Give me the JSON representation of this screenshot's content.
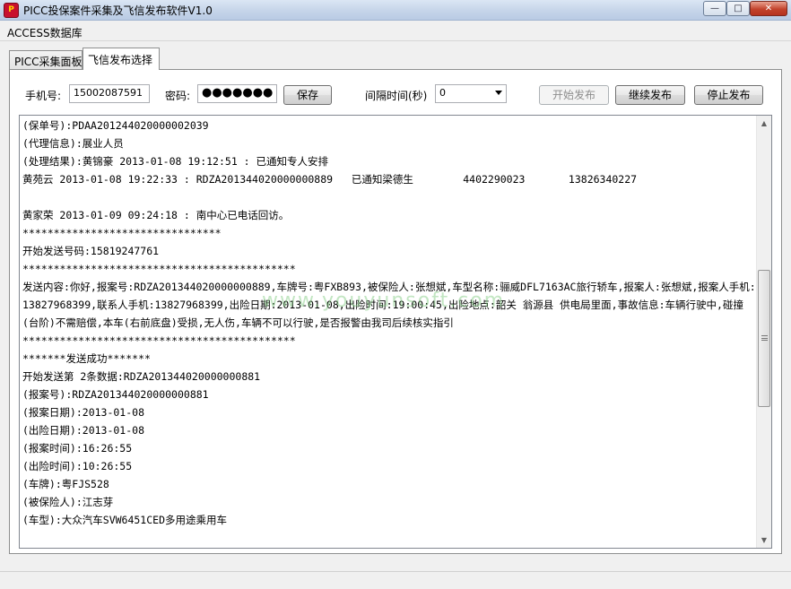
{
  "window": {
    "title": "PICC投保案件采集及飞信发布软件V1.0",
    "minimize_glyph": "—",
    "maximize_glyph": "□",
    "close_glyph": "✕",
    "app_icon_text": "P"
  },
  "menu": {
    "items": [
      "ACCESS数据库"
    ]
  },
  "tabs": [
    {
      "label": "PICC采集面板"
    },
    {
      "label": "飞信发布选择"
    }
  ],
  "form": {
    "phone_label": "手机号:",
    "phone_value": "15002087591",
    "password_label": "密码:",
    "password_value": "●●●●●●●",
    "save_label": "保存",
    "interval_label": "间隔时间(秒)",
    "interval_value": "0",
    "start_label": "开始发布",
    "continue_label": "继续发布",
    "stop_label": "停止发布"
  },
  "log": {
    "lines": [
      "(保单号):PDAA201244020000002039",
      "(代理信息):展业人员",
      "(处理结果):黄锦豪 2013-01-08 19:12:51 : 已通知专人安排",
      "黄苑云 2013-01-08 19:22:33 : RDZA201344020000000889   已通知梁德生        4402290023       13826340227",
      "",
      "黄家荣 2013-01-09 09:24:18 : 南中心已电话回访。",
      "********************************",
      "开始发送号码:15819247761",
      "********************************************",
      "发送内容:你好,报案号:RDZA201344020000000889,车牌号:粤FXB893,被保险人:张想斌,车型名称:骊威DFL7163AC旅行轿车,报案人:张想斌,报案人手机:13827968399,联系人手机:13827968399,出险日期:2013-01-08,出险时间:19:00:45,出险地点:韶关 翁源县 供电局里面,事故信息:车辆行驶中,碰撞(台阶)不需赔偿,本车(右前底盘)受损,无人伤,车辆不可以行驶,是否报警由我司后续核实指引",
      "********************************************",
      "*******发送成功*******",
      "开始发送第 2条数据:RDZA201344020000000881",
      "(报案号):RDZA201344020000000881",
      "(报案日期):2013-01-08",
      "(出险日期):2013-01-08",
      "(报案时间):16:26:55",
      "(出险时间):10:26:55",
      "(车牌):粤FJS528",
      "(被保险人):江志芽",
      "(车型):大众汽车SVW6451CED多用途乘用车"
    ],
    "watermark": "www.youyunsoft.com"
  },
  "scrollbar": {
    "up_glyph": "▲",
    "down_glyph": "▼"
  }
}
